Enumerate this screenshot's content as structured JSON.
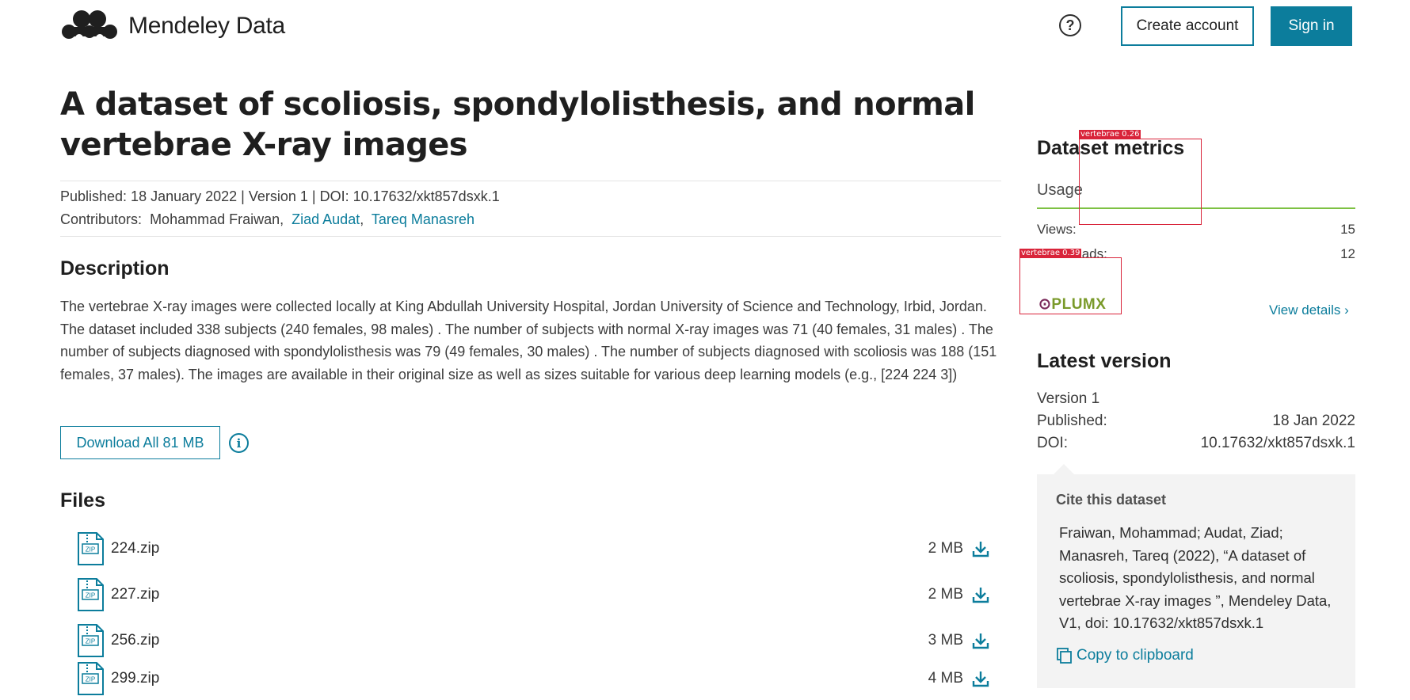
{
  "header": {
    "app_name": "Mendeley Data",
    "help_label": "?",
    "create_account": "Create account",
    "sign_in": "Sign in"
  },
  "dataset": {
    "title": "A dataset of scoliosis, spondylolisthesis, and normal vertebrae X-ray images",
    "published_line": "Published: 18 January 2022 | Version 1 | DOI: 10.17632/xkt857dsxk.1",
    "contributors_label": "Contributors:",
    "contributors": [
      "Mohammad Fraiwan",
      "Ziad Audat",
      "Tareq Manasreh"
    ]
  },
  "description": {
    "heading": "Description",
    "text": "The vertebrae X-ray images were collected locally at King Abdullah University Hospital, Jordan University of Science and Technology, Irbid, Jordan. The dataset included 338 subjects (240 females, 98 males) . The number of subjects with normal X-ray images was 71 (40 females, 31 males) . The number of subjects diagnosed with spondylolisthesis was 79 (49 females, 30 males) . The number of subjects diagnosed with scoliosis was 188 (151 females, 37 males). The images are available in their original size as well as sizes suitable for various deep learning models (e.g., [224 224 3])",
    "download_all": "Download All 81 MB",
    "info_icon": "i"
  },
  "files": {
    "heading": "Files",
    "icon_label": "ZIP",
    "items": [
      {
        "name": "224.zip",
        "size": "2 MB"
      },
      {
        "name": "227.zip",
        "size": "2 MB"
      },
      {
        "name": "256.zip",
        "size": "3 MB"
      },
      {
        "name": "299.zip",
        "size": "4 MB"
      }
    ]
  },
  "metrics": {
    "heading": "Dataset metrics",
    "usage": "Usage",
    "views_label": "Views:",
    "views_value": "15",
    "downloads_label": "Downloads:",
    "downloads_value": "12",
    "plumx_p": "",
    "plumx_text": "PLUMX",
    "view_details": "View details ›"
  },
  "latest_version": {
    "heading": "Latest version",
    "version": "Version 1",
    "published_label": "Published:",
    "published_value": "18 Jan 2022",
    "doi_label": "DOI:",
    "doi_value": "10.17632/xkt857dsxk.1"
  },
  "cite": {
    "title": "Cite this dataset",
    "text": "Fraiwan, Mohammad; Audat, Ziad; Manasreh, Tareq (2022), “A dataset of scoliosis, spondylolisthesis, and normal vertebrae X-ray images ”, Mendeley Data, V1, doi: 10.17632/xkt857dsxk.1",
    "copy_label": "Copy to clipboard"
  },
  "overlays": [
    {
      "label": "vertebrae 0.26"
    },
    {
      "label": "vertebrae 0.39"
    }
  ],
  "colors": {
    "accent": "#0c7d9c",
    "usage_line": "#7dc142",
    "overlay": "#d9243a"
  }
}
